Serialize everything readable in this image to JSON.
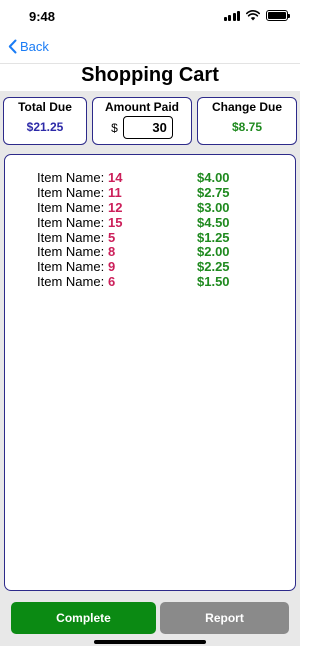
{
  "status": {
    "time": "9:48",
    "battery_level": 1.0
  },
  "nav": {
    "back_label": "Back"
  },
  "page": {
    "title": "Shopping Cart"
  },
  "summary": {
    "total_due_label": "Total Due",
    "total_due_value": "$21.25",
    "amount_paid_label": "Amount Paid",
    "currency_symbol": "$",
    "amount_paid_value": "30",
    "change_due_label": "Change Due",
    "change_due_value": "$8.75"
  },
  "items": {
    "label": "Item Name:",
    "rows": [
      {
        "name": "14",
        "price": "$4.00"
      },
      {
        "name": "11",
        "price": "$2.75"
      },
      {
        "name": "12",
        "price": "$3.00"
      },
      {
        "name": "15",
        "price": "$4.50"
      },
      {
        "name": "5",
        "price": "$1.25"
      },
      {
        "name": "8",
        "price": "$2.00"
      },
      {
        "name": "9",
        "price": "$2.25"
      },
      {
        "name": "6",
        "price": "$1.50"
      }
    ]
  },
  "buttons": {
    "complete_label": "Complete",
    "report_label": "Report"
  },
  "colors": {
    "accent_blue": "#1a7cf5",
    "border_navy": "#2d2a8a",
    "item_name_red": "#cc1f5a",
    "price_green": "#1f8a1f",
    "complete_green": "#0b8a13",
    "report_gray": "#8a8a8a"
  }
}
